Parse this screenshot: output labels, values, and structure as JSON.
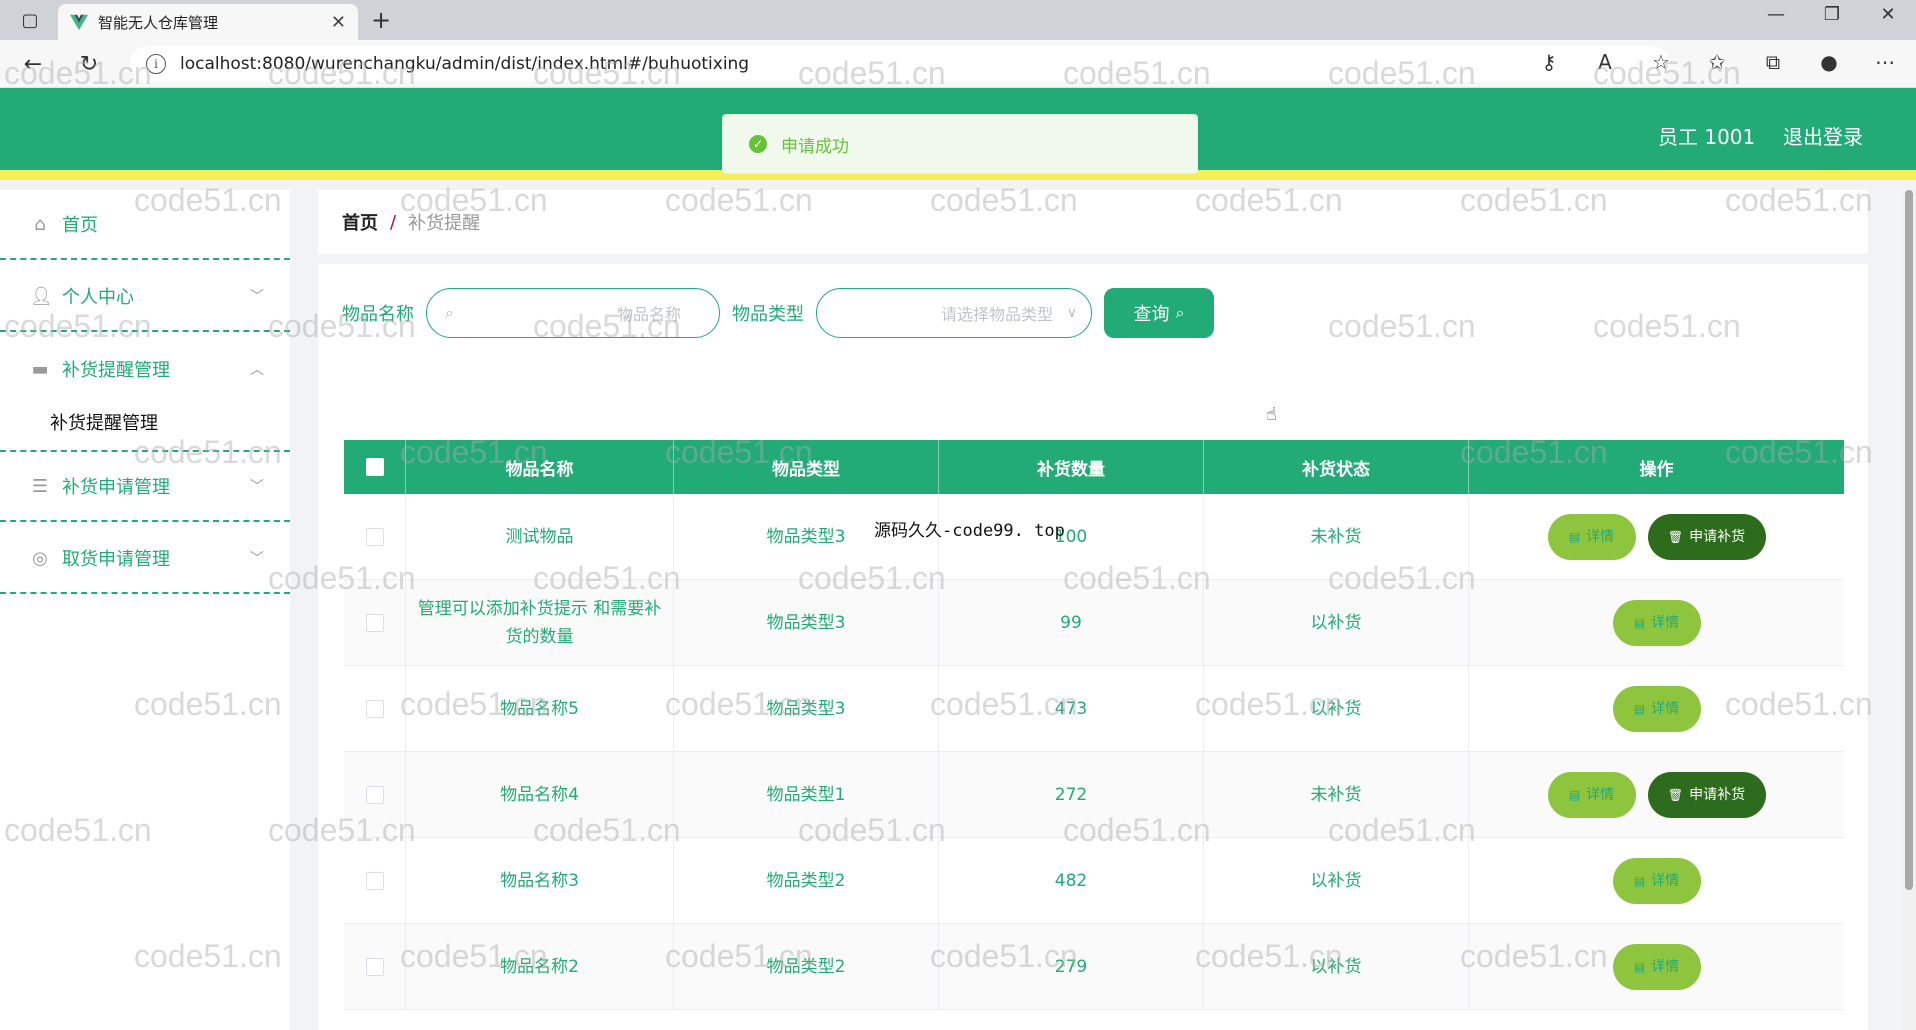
{
  "browser": {
    "tab_title": "智能无人仓库管理",
    "url": "localhost:8080/wurenchangku/admin/dist/index.html#/buhuotixing"
  },
  "header": {
    "user": "员工 1001",
    "logout": "退出登录"
  },
  "toast": {
    "message": "申请成功"
  },
  "sidebar": {
    "items": [
      {
        "label": "首页"
      },
      {
        "label": "个人中心"
      },
      {
        "label": "补货提醒管理"
      },
      {
        "label": "补货提醒管理"
      },
      {
        "label": "补货申请管理"
      },
      {
        "label": "取货申请管理"
      }
    ]
  },
  "breadcrumb": {
    "home": "首页",
    "sep": "/",
    "current": "补货提醒"
  },
  "search": {
    "name_label": "物品名称",
    "name_placeholder": "物品名称",
    "type_label": "物品类型",
    "type_placeholder": "请选择物品类型",
    "query_button": "查询"
  },
  "table": {
    "headers": [
      "物品名称",
      "物品类型",
      "补货数量",
      "补货状态",
      "操作"
    ],
    "rows": [
      {
        "name": "测试物品",
        "type": "物品类型3",
        "qty": "100",
        "status": "未补货"
      },
      {
        "name": "管理可以添加补货提示 和需要补货的数量",
        "type": "物品类型3",
        "qty": "99",
        "status": "以补货"
      },
      {
        "name": "物品名称5",
        "type": "物品类型3",
        "qty": "473",
        "status": "以补货"
      },
      {
        "name": "物品名称4",
        "type": "物品类型1",
        "qty": "272",
        "status": "未补货"
      },
      {
        "name": "物品名称3",
        "type": "物品类型2",
        "qty": "482",
        "status": "以补货"
      },
      {
        "name": "物品名称2",
        "type": "物品类型2",
        "qty": "279",
        "status": "以补货"
      }
    ],
    "detail_label": "详情",
    "apply_label": "申请补货"
  },
  "overlay_text": "源码久久-code99. top",
  "watermark": "code51.cn",
  "colors": {
    "primary": "#22aa77",
    "accent_bar": "#f4f05a",
    "detail_btn": "#8ec53f",
    "apply_btn": "#2e6c1d"
  }
}
